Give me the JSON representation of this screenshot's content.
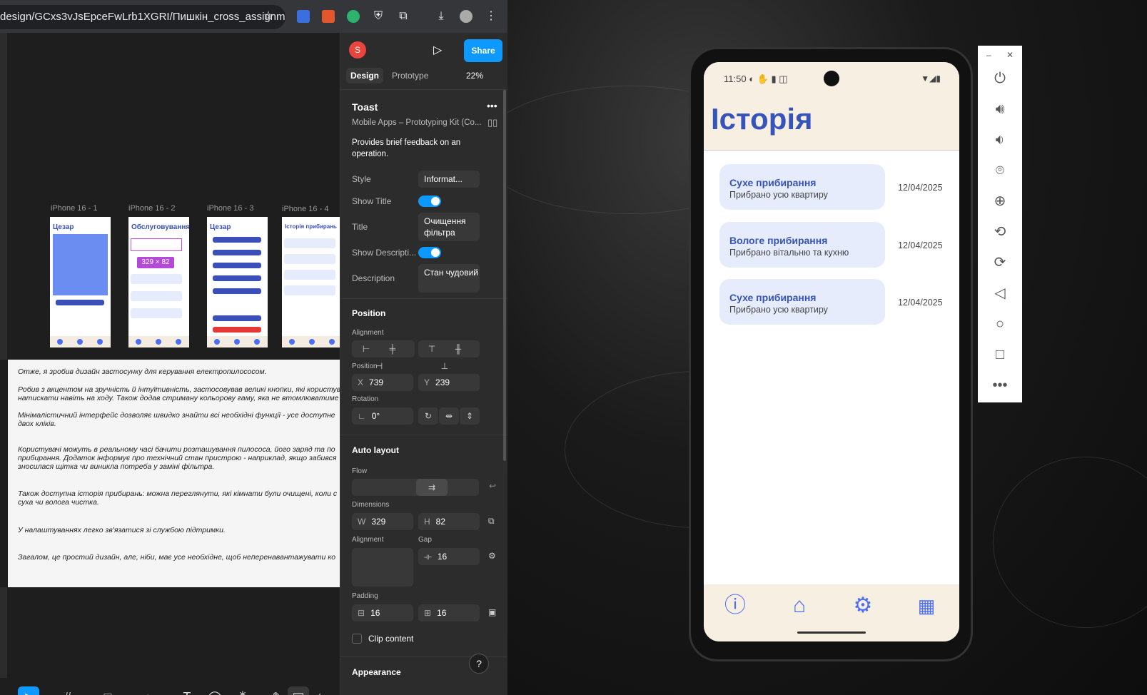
{
  "browser": {
    "url": "design/GCxs3vJsEpceFwLrb1XGRI/Пишкін_cross_assignm..."
  },
  "canvas": {
    "frames": [
      {
        "label": "iPhone 16 - 1",
        "title": "Цезар"
      },
      {
        "label": "iPhone 16 - 2",
        "title": "Обслуговування",
        "dim": "329 × 82"
      },
      {
        "label": "iPhone 16 - 3",
        "title": "Цезар"
      },
      {
        "label": "iPhone 16 - 4",
        "title": "Історія прибирань"
      }
    ],
    "paragraphs": [
      "Отже, я зробив дизайн застосунку для керування електропилососом.",
      "Робив з акцентом на зручність й інтуїтивність, застосовував великі кнопки, які користув\nнатискати навіть на ходу. Також додав стриману кольорову гаму, яка не втомлюватиме",
      "Мінімалістичний інтерфейс дозволяє швидко знайти всі необхідні функції - усе доступне\nдвох кліків.",
      "Користувачі можуть в реальному часі бачити розташування пилососа, його заряд та по\nприбирання. Додаток інформує про технічний стан пристрою - наприклад, якщо забився\nзносилася щітка чи виникла потреба у заміні фільтра.",
      "Також доступна історія прибирань: можна переглянути, які кімнати були очищені, коли с\nсуха чи волога чистка.",
      "У налаштуваннях легко зв'язатися зі службою підтримки.",
      "Загалом, це простий дизайн, але, ніби, має усе необхідне, щоб неперенавантажувати ко"
    ]
  },
  "panel": {
    "avatar": "S",
    "share": "Share",
    "tabs": [
      "Design",
      "Prototype"
    ],
    "zoom": "22%",
    "component": "Toast",
    "library": "Mobile Apps – Prototyping Kit (Co...",
    "description": "Provides brief feedback on an operation.",
    "props": {
      "style_label": "Style",
      "style_value": "Informat...",
      "show_title_label": "Show Title",
      "title_label": "Title",
      "title_value": "Очищення фільтра",
      "show_desc_label": "Show Descripti...",
      "desc_label": "Description",
      "desc_value": "Стан чудовий"
    },
    "position": {
      "heading": "Position",
      "alignment": "Alignment",
      "position_label": "Position",
      "x_label": "X",
      "x": "739",
      "y_label": "Y",
      "y": "239",
      "rotation_label": "Rotation",
      "rotation": "0°"
    },
    "autolayout": {
      "heading": "Auto layout",
      "flow": "Flow",
      "dimensions": "Dimensions",
      "w_label": "W",
      "w": "329",
      "h_label": "H",
      "h": "82",
      "alignment": "Alignment",
      "gap_label": "Gap",
      "gap": "16",
      "padding": "Padding",
      "pad_h": "16",
      "pad_v": "16",
      "clip": "Clip content"
    },
    "appearance": "Appearance"
  },
  "phone": {
    "time": "11:50",
    "title": "Історія",
    "items": [
      {
        "title": "Сухе прибирання",
        "subtitle": "Прибрано усю квартиру",
        "date": "12/04/2025"
      },
      {
        "title": "Вологе прибирання",
        "subtitle": "Прибрано вітальню та кухню",
        "date": "12/04/2025"
      },
      {
        "title": "Сухе прибирання",
        "subtitle": "Прибрано усю квартиру",
        "date": "12/04/2025"
      }
    ]
  },
  "icons": {
    "nav": [
      "info-icon",
      "home-icon",
      "settings-icon",
      "calculator-icon"
    ]
  },
  "colors": {
    "primary": "#3754b8",
    "accent": "#4b6ef5",
    "share": "#0d99ff",
    "appbar": "#f8efe3",
    "card": "#e6ecfb"
  }
}
